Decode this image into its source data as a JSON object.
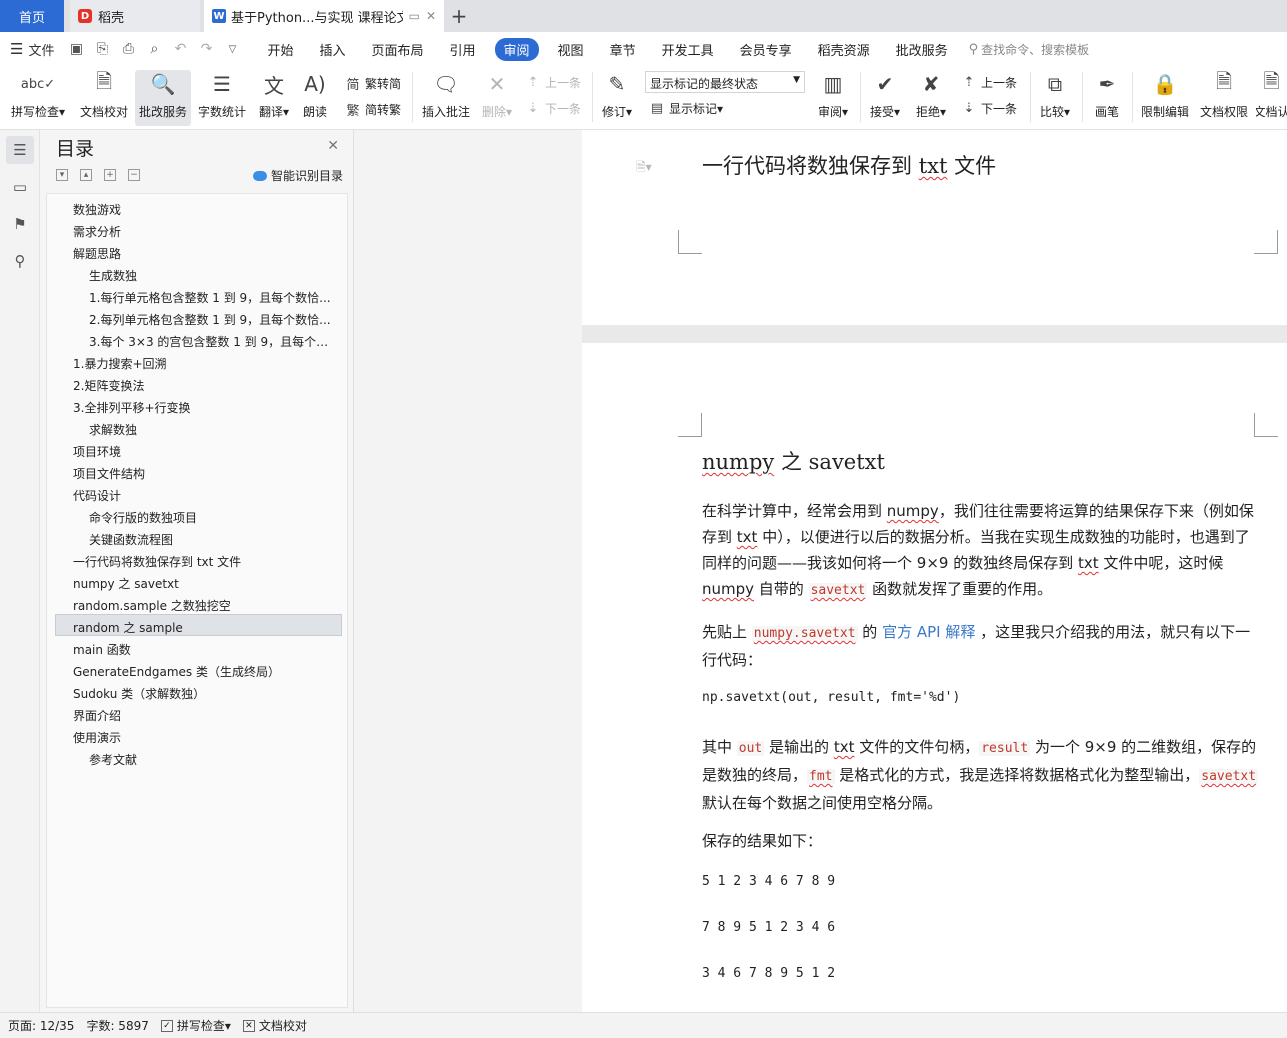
{
  "tabs": {
    "home": "首页",
    "daoke": "稻壳",
    "doc_title": "基于Python...与实现 课程论文",
    "add_icon": "plus-icon"
  },
  "menu": {
    "file": "文件",
    "items": [
      "开始",
      "插入",
      "页面布局",
      "引用",
      "审阅",
      "视图",
      "章节",
      "开发工具",
      "会员专享",
      "稻壳资源",
      "批改服务"
    ],
    "active": "审阅",
    "search_placeholder": "查找命令、搜索模板"
  },
  "ribbon": {
    "spell_check": "拼写检查",
    "doc_proof": "文档校对",
    "grading": "批改服务",
    "word_count": "字数统计",
    "translate": "翻译",
    "read_aloud": "朗读",
    "to_traditional": "繁转简",
    "to_simplified": "简转繁",
    "insert_comment": "插入批注",
    "delete": "删除",
    "prev": "上一条",
    "next": "下一条",
    "revise": "修订",
    "markup_select": "显示标记的最终状态",
    "show_markup": "显示标记",
    "review": "审阅",
    "accept": "接受",
    "reject": "拒绝",
    "prev2": "上一条",
    "next2": "下一条",
    "compare": "比较",
    "pen": "画笔",
    "restrict_edit": "限制编辑",
    "doc_permission": "文档权限",
    "doc_more": "文档认"
  },
  "toc": {
    "title": "目录",
    "smart": "智能识别目录",
    "items": [
      {
        "text": "数独游戏",
        "level": 1
      },
      {
        "text": "需求分析",
        "level": 1
      },
      {
        "text": "解题思路",
        "level": 1,
        "expand": true
      },
      {
        "text": "生成数独",
        "level": 2
      },
      {
        "text": "1.每行单元格包含整数 1 到 9，且每个数恰...",
        "level": 2
      },
      {
        "text": "2.每列单元格包含整数 1 到 9，且每个数恰...",
        "level": 2
      },
      {
        "text": "3.每个 3×3 的宫包含整数 1 到 9，且每个数...",
        "level": 2
      },
      {
        "text": "1.暴力搜索+回溯",
        "level": 1
      },
      {
        "text": "2.矩阵变换法",
        "level": 1
      },
      {
        "text": "3.全排列平移+行变换",
        "level": 1,
        "expand": true
      },
      {
        "text": "求解数独",
        "level": 2
      },
      {
        "text": "项目环境",
        "level": 1
      },
      {
        "text": "项目文件结构",
        "level": 1
      },
      {
        "text": "代码设计",
        "level": 1,
        "expand": true
      },
      {
        "text": "命令行版的数独项目",
        "level": 2
      },
      {
        "text": "关键函数流程图",
        "level": 2
      },
      {
        "text": "一行代码将数独保存到 txt 文件",
        "level": 1
      },
      {
        "text": "numpy 之 savetxt",
        "level": 1
      },
      {
        "text": "random.sample 之数独挖空",
        "level": 1
      },
      {
        "text": "random 之 sample",
        "level": 1
      },
      {
        "text": "main 函数",
        "level": 1
      },
      {
        "text": "GenerateEndgames 类（生成终局）",
        "level": 1
      },
      {
        "text": "Sudoku 类（求解数独）",
        "level": 1
      },
      {
        "text": "界面介绍",
        "level": 1
      },
      {
        "text": "使用演示",
        "level": 1,
        "expand": true
      },
      {
        "text": "参考文献",
        "level": 2
      }
    ]
  },
  "doc": {
    "prev_heading_a": "一行代码将数独保存到 ",
    "prev_heading_b": "txt",
    "prev_heading_c": " 文件",
    "heading_a": "numpy",
    "heading_b": " 之 ",
    "heading_c": "savetxt",
    "p1_a": "在科学计算中，经常会用到 ",
    "p1_b": "numpy",
    "p1_c": "，我们往往需要将运算的结果保存下来（例如保存到 ",
    "p1_d": "txt",
    "p1_e": " 中），以便进行以后的数据分析。当我在实现生成数独的功能时，也遇到了同样的问题——我该如何将一个 9×9 的数独终局保存到 ",
    "p1_f": "txt",
    "p1_g": " 文件中呢，这时候 ",
    "p1_h": "numpy",
    "p1_i": " 自带的 ",
    "p1_j": "savetxt",
    "p1_k": " 函数就发挥了重要的作用。",
    "p2_a": "先贴上 ",
    "p2_b": "numpy.savetxt",
    "p2_c": " 的 ",
    "p2_d": "官方 API 解释",
    "p2_e": " ，这里我只介绍我的用法，就只有以下一行代码：",
    "code_line": "np.savetxt(out, result, fmt='%d')",
    "p3_a": "其中 ",
    "p3_b": "out",
    "p3_c": " 是输出的 ",
    "p3_d": "txt",
    "p3_e": " 文件的文件句柄，",
    "p3_f": "result",
    "p3_g": " 为一个 9×9 的二维数组，保存的是数独的终局，",
    "p3_h": "fmt",
    "p3_i": " 是格式化的方式，我是选择将数据格式化为整型输出，",
    "p3_j": "savetxt",
    "p3_k": " 默认在每个数据之间使用空格分隔。",
    "p4": "保存的结果如下：",
    "rows": [
      "5 1 2 3 4 6 7 8 9",
      "7 8 9 5 1 2 3 4 6",
      "3 4 6 7 8 9 5 1 2"
    ]
  },
  "status": {
    "page": "页面: 12/35",
    "words": "字数: 5897",
    "spell": "拼写检查",
    "proof": "文档校对"
  }
}
